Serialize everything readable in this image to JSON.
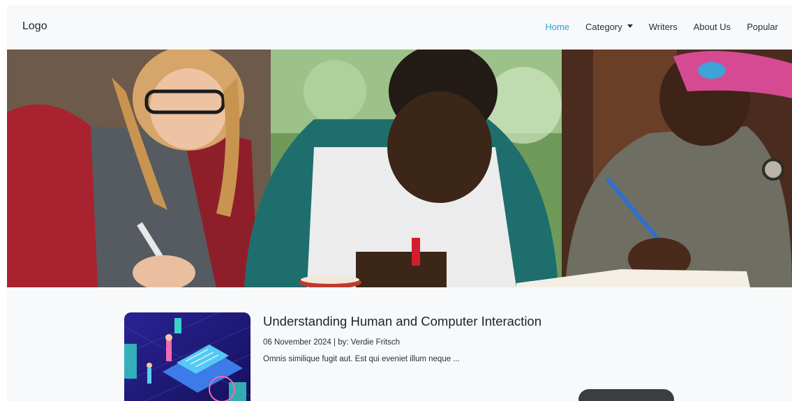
{
  "navbar": {
    "logo": "Logo",
    "items": [
      {
        "label": "Home",
        "active": true
      },
      {
        "label": "Category",
        "dropdown": true
      },
      {
        "label": "Writers"
      },
      {
        "label": "About Us"
      },
      {
        "label": "Popular"
      }
    ]
  },
  "colors": {
    "background": "#f8f9fb",
    "active_link": "#2aa3c4",
    "text": "#212529"
  },
  "post": {
    "title": "Understanding Human and Computer Interaction",
    "date": "06 November 2024",
    "separator": "|",
    "author_prefix": "by:",
    "author": "Verdie Fritsch",
    "excerpt": "Omnis similique fugit aut. Est qui eveniet illum neque ..."
  }
}
